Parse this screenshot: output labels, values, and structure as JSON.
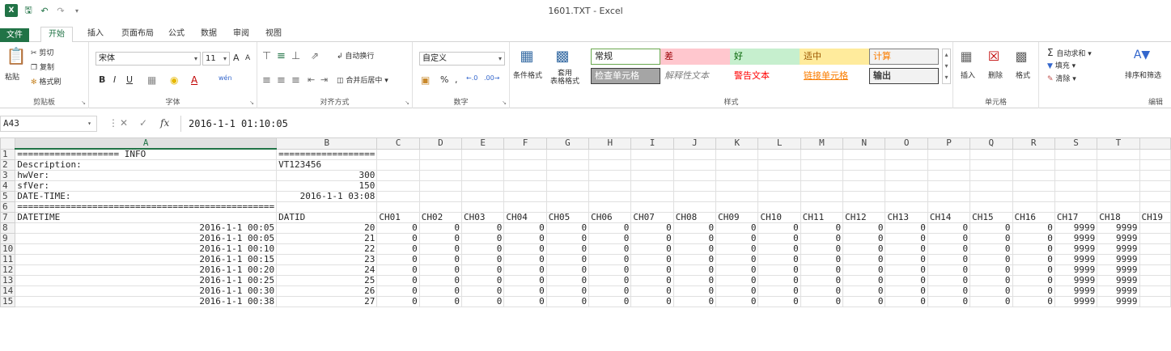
{
  "window": {
    "title": "1601.TXT - Excel",
    "logo": "X"
  },
  "tabs": [
    "文件",
    "开始",
    "插入",
    "页面布局",
    "公式",
    "数据",
    "审阅",
    "视图"
  ],
  "clipboard": {
    "paste": "粘贴",
    "cut": "剪切",
    "copy": "复制",
    "format_painter": "格式刷",
    "label": "剪贴板"
  },
  "font": {
    "name": "宋体",
    "size": "11",
    "bold": "B",
    "italic": "I",
    "underline": "U",
    "label": "字体",
    "grow": "A",
    "shrink": "A",
    "phonetic": "wén"
  },
  "alignment": {
    "wrap": "自动换行",
    "merge": "合并后居中",
    "label": "对齐方式"
  },
  "number": {
    "format": "自定义",
    "percent": "%",
    "comma": ",",
    "label": "数字"
  },
  "styles_group": {
    "conditional": "条件格式",
    "table": "套用\n表格格式",
    "cells": [
      {
        "text": "常规",
        "bg": "#ffffff",
        "fg": "#222222",
        "border": "#6aa84f"
      },
      {
        "text": "差",
        "bg": "#ffc7ce",
        "fg": "#9c0006",
        "border": "#ffc7ce"
      },
      {
        "text": "好",
        "bg": "#c6efce",
        "fg": "#006100",
        "border": "#c6efce"
      },
      {
        "text": "适中",
        "bg": "#ffeb9c",
        "fg": "#9c5700",
        "border": "#ffeb9c"
      },
      {
        "text": "计算",
        "bg": "#f2f2f2",
        "fg": "#fa7d00",
        "border": "#7f7f7f"
      },
      {
        "text": "检查单元格",
        "bg": "#a5a5a5",
        "fg": "#ffffff",
        "border": "#3f3f3f"
      },
      {
        "text": "解释性文本",
        "bg": "#ffffff",
        "fg": "#7f7f7f",
        "border": "#ffffff"
      },
      {
        "text": "警告文本",
        "bg": "#ffffff",
        "fg": "#ff0000",
        "border": "#ffffff"
      },
      {
        "text": "链接单元格",
        "bg": "#ffffff",
        "fg": "#fa7d00",
        "border": "#ffffff"
      },
      {
        "text": "输出",
        "bg": "#f2f2f2",
        "fg": "#3f3f3f",
        "border": "#3f3f3f"
      }
    ],
    "label": "样式"
  },
  "cells_group": {
    "insert": "插入",
    "delete": "删除",
    "format": "格式",
    "label": "单元格"
  },
  "editing": {
    "autosum": "自动求和",
    "fill": "填充",
    "clear": "清除",
    "sort": "排序和筛选",
    "label": "编辑"
  },
  "formula_bar": {
    "cell_ref": "A43",
    "fx": "fx",
    "value": "2016-1-1  01:10:05"
  },
  "columns": [
    "A",
    "B",
    "C",
    "D",
    "E",
    "F",
    "G",
    "H",
    "I",
    "J",
    "K",
    "L",
    "M",
    "N",
    "O",
    "P",
    "Q",
    "R",
    "S",
    "T"
  ],
  "rows": [
    {
      "n": "1",
      "cells": [
        "=================== INFO",
        "==================",
        "",
        "",
        "",
        "",
        "",
        "",
        "",
        "",
        "",
        "",
        "",
        "",
        "",
        "",
        "",
        "",
        "",
        ""
      ]
    },
    {
      "n": "2",
      "cells": [
        "Description:",
        "VT123456",
        "",
        "",
        "",
        "",
        "",
        "",
        "",
        "",
        "",
        "",
        "",
        "",
        "",
        "",
        "",
        "",
        "",
        ""
      ]
    },
    {
      "n": "3",
      "cells": [
        "hwVer:",
        "300",
        "",
        "",
        "",
        "",
        "",
        "",
        "",
        "",
        "",
        "",
        "",
        "",
        "",
        "",
        "",
        "",
        "",
        ""
      ]
    },
    {
      "n": "4",
      "cells": [
        "sfVer:",
        "150",
        "",
        "",
        "",
        "",
        "",
        "",
        "",
        "",
        "",
        "",
        "",
        "",
        "",
        "",
        "",
        "",
        "",
        ""
      ]
    },
    {
      "n": "5",
      "cells": [
        "DATE-TIME:",
        "2016-1-1 03:08",
        "",
        "",
        "",
        "",
        "",
        "",
        "",
        "",
        "",
        "",
        "",
        "",
        "",
        "",
        "",
        "",
        "",
        ""
      ]
    },
    {
      "n": "6",
      "cells": [
        "================================================",
        "",
        "",
        "",
        "",
        "",
        "",
        "",
        "",
        "",
        "",
        "",
        "",
        "",
        "",
        "",
        "",
        "",
        "",
        ""
      ]
    },
    {
      "n": "7",
      "cells": [
        "DATETIME",
        "DATID",
        "CH01",
        "CH02",
        "CH03",
        "CH04",
        "CH05",
        "CH06",
        "CH07",
        "CH08",
        "CH09",
        "CH10",
        "CH11",
        "CH12",
        "CH13",
        "CH14",
        "CH15",
        "CH16",
        "CH17",
        "CH18"
      ]
    },
    {
      "n": "8",
      "cells": [
        "2016-1-1 00:05",
        "20",
        "0",
        "0",
        "0",
        "0",
        "0",
        "0",
        "0",
        "0",
        "0",
        "0",
        "0",
        "0",
        "0",
        "0",
        "0",
        "0",
        "9999",
        "9999"
      ]
    },
    {
      "n": "9",
      "cells": [
        "2016-1-1 00:05",
        "21",
        "0",
        "0",
        "0",
        "0",
        "0",
        "0",
        "0",
        "0",
        "0",
        "0",
        "0",
        "0",
        "0",
        "0",
        "0",
        "0",
        "9999",
        "9999"
      ]
    },
    {
      "n": "10",
      "cells": [
        "2016-1-1 00:10",
        "22",
        "0",
        "0",
        "0",
        "0",
        "0",
        "0",
        "0",
        "0",
        "0",
        "0",
        "0",
        "0",
        "0",
        "0",
        "0",
        "0",
        "9999",
        "9999"
      ]
    },
    {
      "n": "11",
      "cells": [
        "2016-1-1 00:15",
        "23",
        "0",
        "0",
        "0",
        "0",
        "0",
        "0",
        "0",
        "0",
        "0",
        "0",
        "0",
        "0",
        "0",
        "0",
        "0",
        "0",
        "9999",
        "9999"
      ]
    },
    {
      "n": "12",
      "cells": [
        "2016-1-1 00:20",
        "24",
        "0",
        "0",
        "0",
        "0",
        "0",
        "0",
        "0",
        "0",
        "0",
        "0",
        "0",
        "0",
        "0",
        "0",
        "0",
        "0",
        "9999",
        "9999"
      ]
    },
    {
      "n": "13",
      "cells": [
        "2016-1-1 00:25",
        "25",
        "0",
        "0",
        "0",
        "0",
        "0",
        "0",
        "0",
        "0",
        "0",
        "0",
        "0",
        "0",
        "0",
        "0",
        "0",
        "0",
        "9999",
        "9999"
      ]
    },
    {
      "n": "14",
      "cells": [
        "2016-1-1 00:30",
        "26",
        "0",
        "0",
        "0",
        "0",
        "0",
        "0",
        "0",
        "0",
        "0",
        "0",
        "0",
        "0",
        "0",
        "0",
        "0",
        "0",
        "9999",
        "9999"
      ]
    },
    {
      "n": "15",
      "cells": [
        "2016-1-1 00:38",
        "27",
        "0",
        "0",
        "0",
        "0",
        "0",
        "0",
        "0",
        "0",
        "0",
        "0",
        "0",
        "0",
        "0",
        "0",
        "0",
        "0",
        "9999",
        "9999"
      ]
    }
  ],
  "overflow_col": "CH19",
  "accent": "#217346"
}
